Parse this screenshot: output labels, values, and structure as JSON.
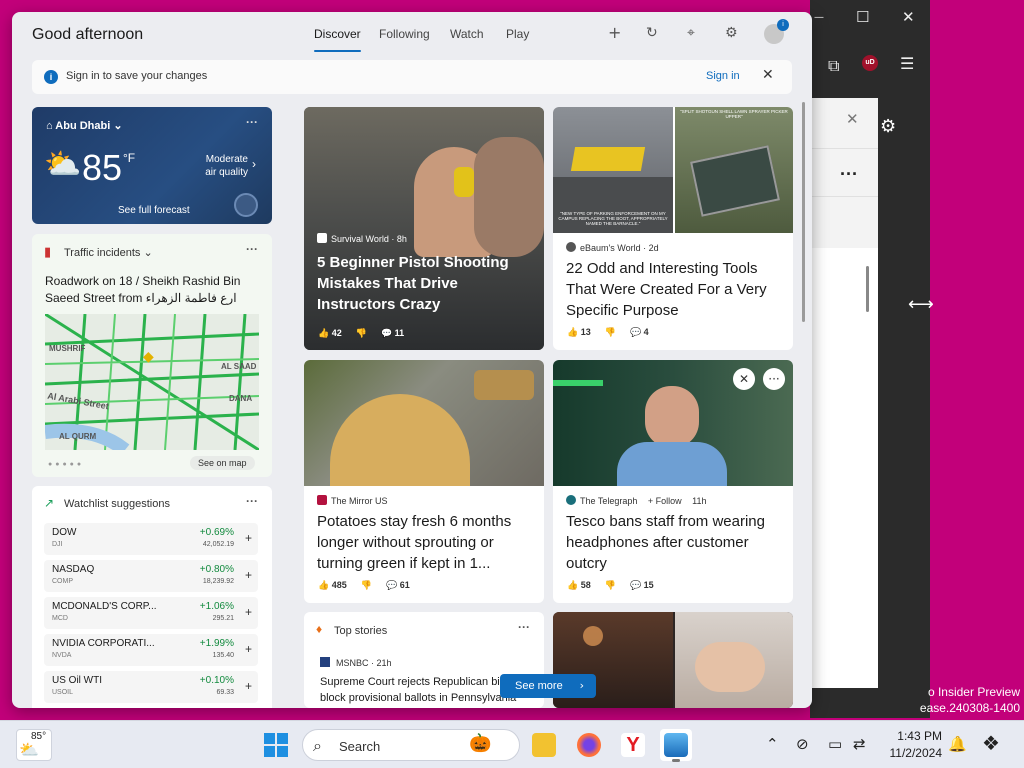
{
  "background": {
    "color": "#c2007a"
  },
  "watermark": {
    "line1": "o Insider Preview",
    "line2": "ease.240308-1400"
  },
  "panel": {
    "greeting": "Good afternoon",
    "tabs": [
      {
        "label": "Discover",
        "active": true
      },
      {
        "label": "Following",
        "active": false
      },
      {
        "label": "Watch",
        "active": false
      },
      {
        "label": "Play",
        "active": false
      }
    ],
    "header_icons": [
      "plus-icon",
      "refresh-icon",
      "pin-icon",
      "settings-icon",
      "profile-icon"
    ],
    "profile_badge": "i",
    "signin_bar": {
      "text": "Sign in to save your changes",
      "link": "Sign in"
    },
    "see_more": "See more"
  },
  "weather": {
    "location": "Abu Dhabi",
    "temperature": "85",
    "unit": "°F",
    "air_quality": "Moderate air quality",
    "forecast_link": "See full forecast"
  },
  "traffic": {
    "title": "Traffic incidents",
    "description": "Roadwork on 18 / Sheikh Rashid Bin Saeed Street from ارع فاطمة الزهراء",
    "map_labels": [
      "MUSHRIF",
      "AL SAAD",
      "DANA",
      "Al Arabi Street",
      "AL QURM"
    ],
    "see_on_map": "See on map"
  },
  "watchlist": {
    "title": "Watchlist suggestions",
    "stocks": [
      {
        "name": "DOW",
        "symbol": "DJI",
        "change": "+0.69%",
        "value": "42,052.19"
      },
      {
        "name": "NASDAQ",
        "symbol": "COMP",
        "change": "+0.80%",
        "value": "18,239.92"
      },
      {
        "name": "MCDONALD'S CORP...",
        "symbol": "MCD",
        "change": "+1.06%",
        "value": "295.21"
      },
      {
        "name": "NVIDIA CORPORATI...",
        "symbol": "NVDA",
        "change": "+1.99%",
        "value": "135.40"
      },
      {
        "name": "US Oil WTI",
        "symbol": "USOIL",
        "change": "+0.10%",
        "value": "69.33"
      }
    ]
  },
  "news": {
    "c1": {
      "source": "Survival World · 8h",
      "headline": "5 Beginner Pistol Shooting Mistakes That Drive Instructors Crazy",
      "likes": "42",
      "comments": "11"
    },
    "c2": {
      "source": "eBaum's World · 2d",
      "headline": "22 Odd and Interesting Tools That Were Created For a Very Specific Purpose",
      "likes": "13",
      "comments": "4",
      "image_text_1": "\"NEW TYPE OF PARKING ENFORCEMENT ON MY CAMPUS REPLACING THE BOOT, APPROPRIATELY NAMED THE BARNACLE.\"",
      "image_text_2": "\"SPLIT SHOTGUN SHELL LAWN SPRAYER PICKER UPPER\""
    },
    "c3": {
      "source": "The Mirror US",
      "headline": "Potatoes stay fresh 6 months longer without sprouting or turning green if kept in 1...",
      "likes": "485",
      "comments": "61"
    },
    "c4": {
      "source": "The Telegraph",
      "follow": "+ Follow",
      "age": "11h",
      "headline": "Tesco bans staff from wearing headphones after customer outcry",
      "likes": "58",
      "comments": "15"
    },
    "top_stories": {
      "title": "Top stories",
      "source": "MSNBC · 21h",
      "headline": "Supreme Court rejects Republican bid to block provisional ballots in Pennsylvania"
    }
  },
  "taskbar": {
    "weather_temp": "85°",
    "search_placeholder": "Search",
    "time": "1:43 PM",
    "date": "11/2/2024",
    "apps": [
      "widgets-app",
      "file-explorer-icon",
      "firefox-icon",
      "yandex-browser-icon",
      "photos-app-icon"
    ],
    "tray_icons": [
      "chevron-up-icon",
      "network-off-icon",
      "device-icon",
      "sync-icon",
      "notification-icon",
      "copilot-icon"
    ]
  }
}
